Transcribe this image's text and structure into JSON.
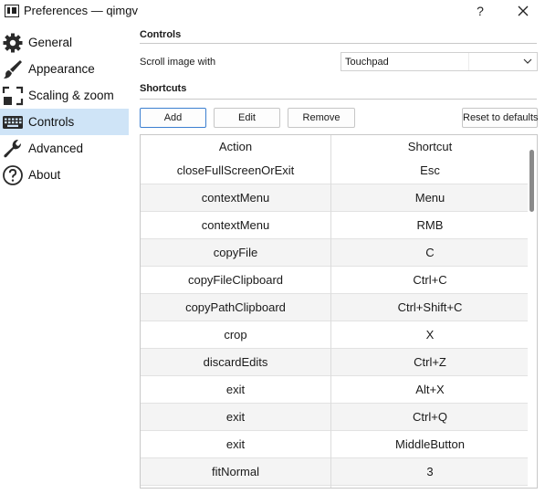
{
  "window": {
    "title": "Preferences — qimgv",
    "help_label": "?",
    "close_icon": "close-icon"
  },
  "sidebar": {
    "items": [
      {
        "label": "General",
        "icon": "gear-icon",
        "active": false
      },
      {
        "label": "Appearance",
        "icon": "brush-icon",
        "active": false
      },
      {
        "label": "Scaling & zoom",
        "icon": "scale-icon",
        "active": false
      },
      {
        "label": "Controls",
        "icon": "keyboard-icon",
        "active": true
      },
      {
        "label": "Advanced",
        "icon": "wrench-icon",
        "active": false
      },
      {
        "label": "About",
        "icon": "question-icon",
        "active": false
      }
    ]
  },
  "controls": {
    "section_title": "Controls",
    "scroll_label": "Scroll image with",
    "scroll_value": "Touchpad"
  },
  "shortcuts": {
    "section_title": "Shortcuts",
    "add_label": "Add",
    "edit_label": "Edit",
    "remove_label": "Remove",
    "reset_label": "Reset to defaults",
    "columns": [
      "Action",
      "Shortcut"
    ],
    "rows": [
      [
        "closeFullScreenOrExit",
        "Esc"
      ],
      [
        "contextMenu",
        "Menu"
      ],
      [
        "contextMenu",
        "RMB"
      ],
      [
        "copyFile",
        "C"
      ],
      [
        "copyFileClipboard",
        "Ctrl+C"
      ],
      [
        "copyPathClipboard",
        "Ctrl+Shift+C"
      ],
      [
        "crop",
        "X"
      ],
      [
        "discardEdits",
        "Ctrl+Z"
      ],
      [
        "exit",
        "Alt+X"
      ],
      [
        "exit",
        "Ctrl+Q"
      ],
      [
        "exit",
        "MiddleButton"
      ],
      [
        "fitNormal",
        "3"
      ]
    ]
  },
  "colors": {
    "selection": "#cfe4f7",
    "primary_border": "#3c7fd0",
    "alt_row": "#f4f4f4"
  }
}
